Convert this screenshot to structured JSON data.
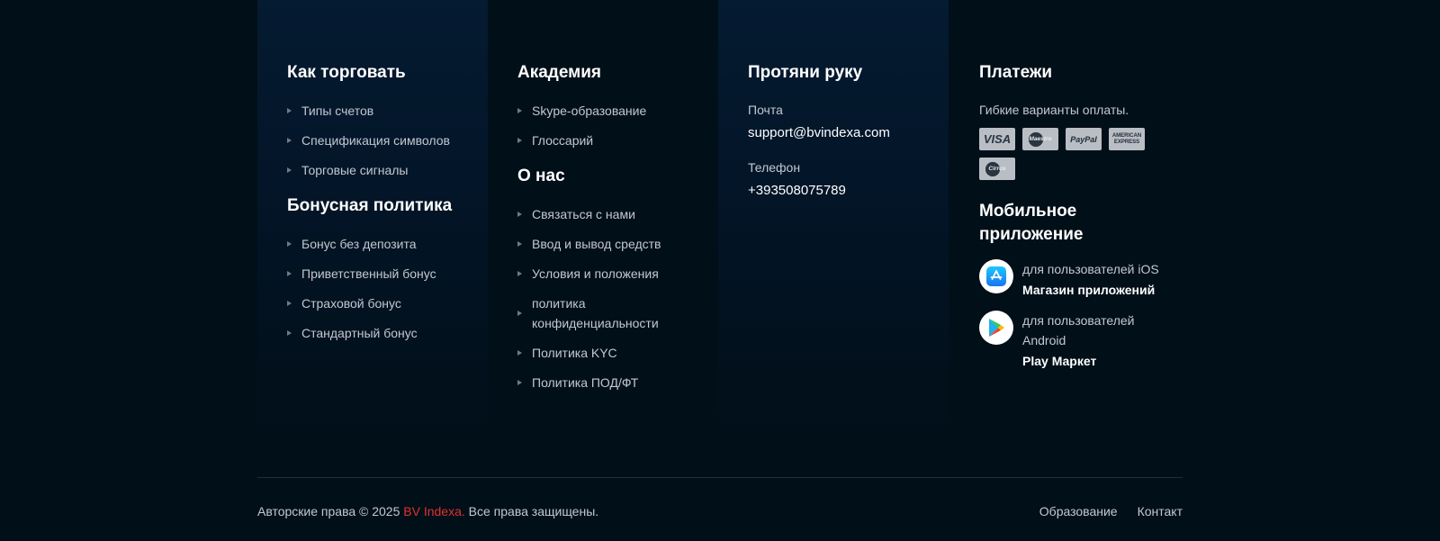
{
  "trade": {
    "title": "Как торговать",
    "links": [
      "Типы счетов",
      "Спецификация символов",
      "Торговые сигналы"
    ]
  },
  "bonus": {
    "title": "Бонусная политика",
    "links": [
      "Бонус без депозита",
      "Приветственный бонус",
      "Страховой бонус",
      "Стандартный бонус"
    ]
  },
  "academy": {
    "title": "Академия",
    "links": [
      "Skype-образование",
      "Глоссарий"
    ]
  },
  "about": {
    "title": "О нас",
    "links": [
      "Связаться с нами",
      "Ввод и вывод средств",
      "Условия и положения",
      "политика конфиденциальности",
      "Политика KYC",
      "Политика ПОД/ФТ"
    ]
  },
  "contact": {
    "title": "Протяни руку",
    "email_label": "Почта",
    "email": "support@bvindexa.com",
    "phone_label": "Телефон",
    "phone": "+393508075789"
  },
  "payments": {
    "title": "Платежи",
    "text": "Гибкие варианты оплаты.",
    "cards": [
      "VISA",
      "Maestro",
      "PayPal",
      "AMERICAN EXPRESS",
      "Cirrus"
    ]
  },
  "mobile": {
    "title": "Мобильное приложение",
    "ios": {
      "for": "для пользователей iOS",
      "store": "Магазин приложений"
    },
    "android": {
      "for": "для пользователей Android",
      "store": "Play Маркет"
    }
  },
  "footer": {
    "copyright_prefix": "Авторские права © 2025 ",
    "brand": "BV Indexa.",
    "copyright_suffix": " Все права защищены.",
    "links": [
      "Образование",
      "Контакт"
    ],
    "brand_color": "#e0322f"
  }
}
